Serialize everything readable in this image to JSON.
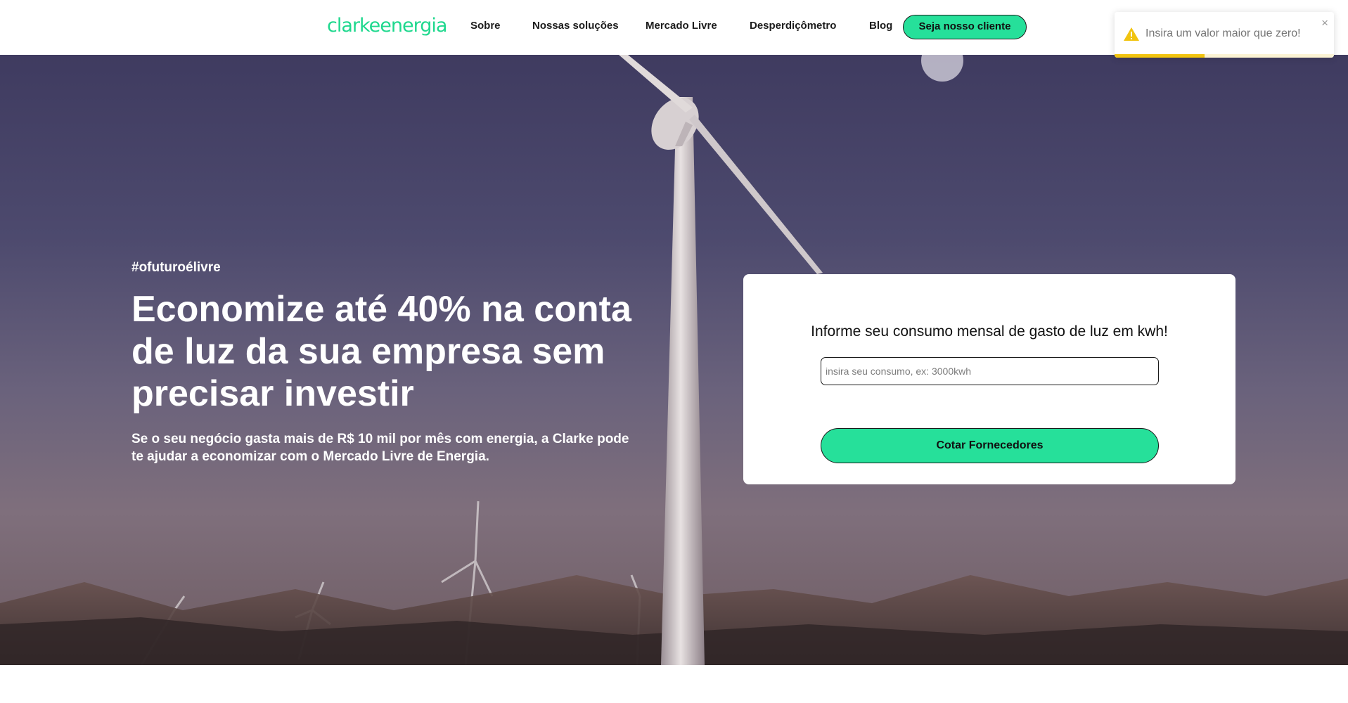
{
  "header": {
    "logo": {
      "part1": "clarke",
      "part2": "energia",
      "color": "#1fd88e"
    },
    "nav": [
      {
        "label": "Sobre"
      },
      {
        "label": "Nossas soluções"
      },
      {
        "label": "Mercado Livre"
      },
      {
        "label": "Desperdiçômetro"
      },
      {
        "label": "Blog"
      }
    ],
    "cta_label": "Seja nosso cliente"
  },
  "toast": {
    "type": "warning",
    "icon": "warning-icon",
    "message": "Insira um valor maior que zero!",
    "close_label": "×",
    "progress": 0.41,
    "color": "#f1c40f"
  },
  "hero": {
    "tag": "#ofuturoélivre",
    "headline": "Economize até 40% na conta de luz da sua empresa sem precisar investir",
    "subline": "Se o seu negócio gasta mais de R$ 10 mil por mês com energia, a Clarke pode te ajudar a economizar com o Mercado Livre de Energia."
  },
  "form": {
    "title": "Informe seu consumo mensal de gasto de luz em kwh!",
    "input_value": "",
    "input_placeholder": "insira seu consumo, ex: 3000kwh",
    "button_label": "Cotar Fornecedores"
  },
  "colors": {
    "accent": "#26e09a",
    "text_dark": "#111111"
  }
}
